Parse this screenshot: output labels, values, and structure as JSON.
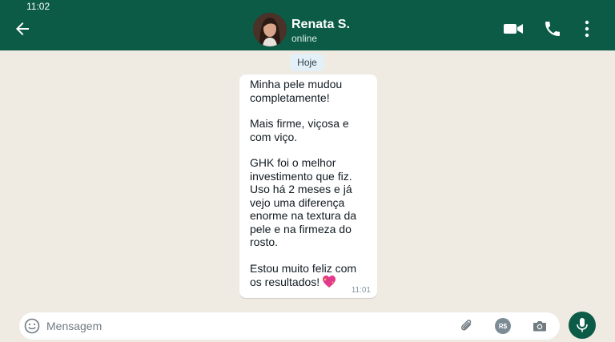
{
  "status_bar": {
    "time": "11:02"
  },
  "header": {
    "contact_name": "Renata S.",
    "contact_status": "online",
    "icons": [
      "back-arrow-icon",
      "video-camera-icon",
      "phone-icon",
      "more-vert-icon"
    ],
    "bg_color": "#0b5b46"
  },
  "chat": {
    "date_label": "Hoje",
    "message": {
      "paragraphs": [
        "Minha pele mudou completamente!",
        "Mais firme, viçosa e com viço.",
        "GHK foi o melhor investimento que fiz. Uso há 2 meses e já vejo uma diferença enorme na textura da pele e na firmeza do rosto.",
        "Estou muito feliz com os resultados!"
      ],
      "emoji": "sparkling-heart-icon",
      "time": "11:01"
    }
  },
  "composer": {
    "placeholder": "Mensagem",
    "payment_label": "R$",
    "icons": [
      "emoji-icon",
      "paperclip-icon",
      "payment-icon",
      "camera-icon",
      "mic-icon"
    ]
  }
}
